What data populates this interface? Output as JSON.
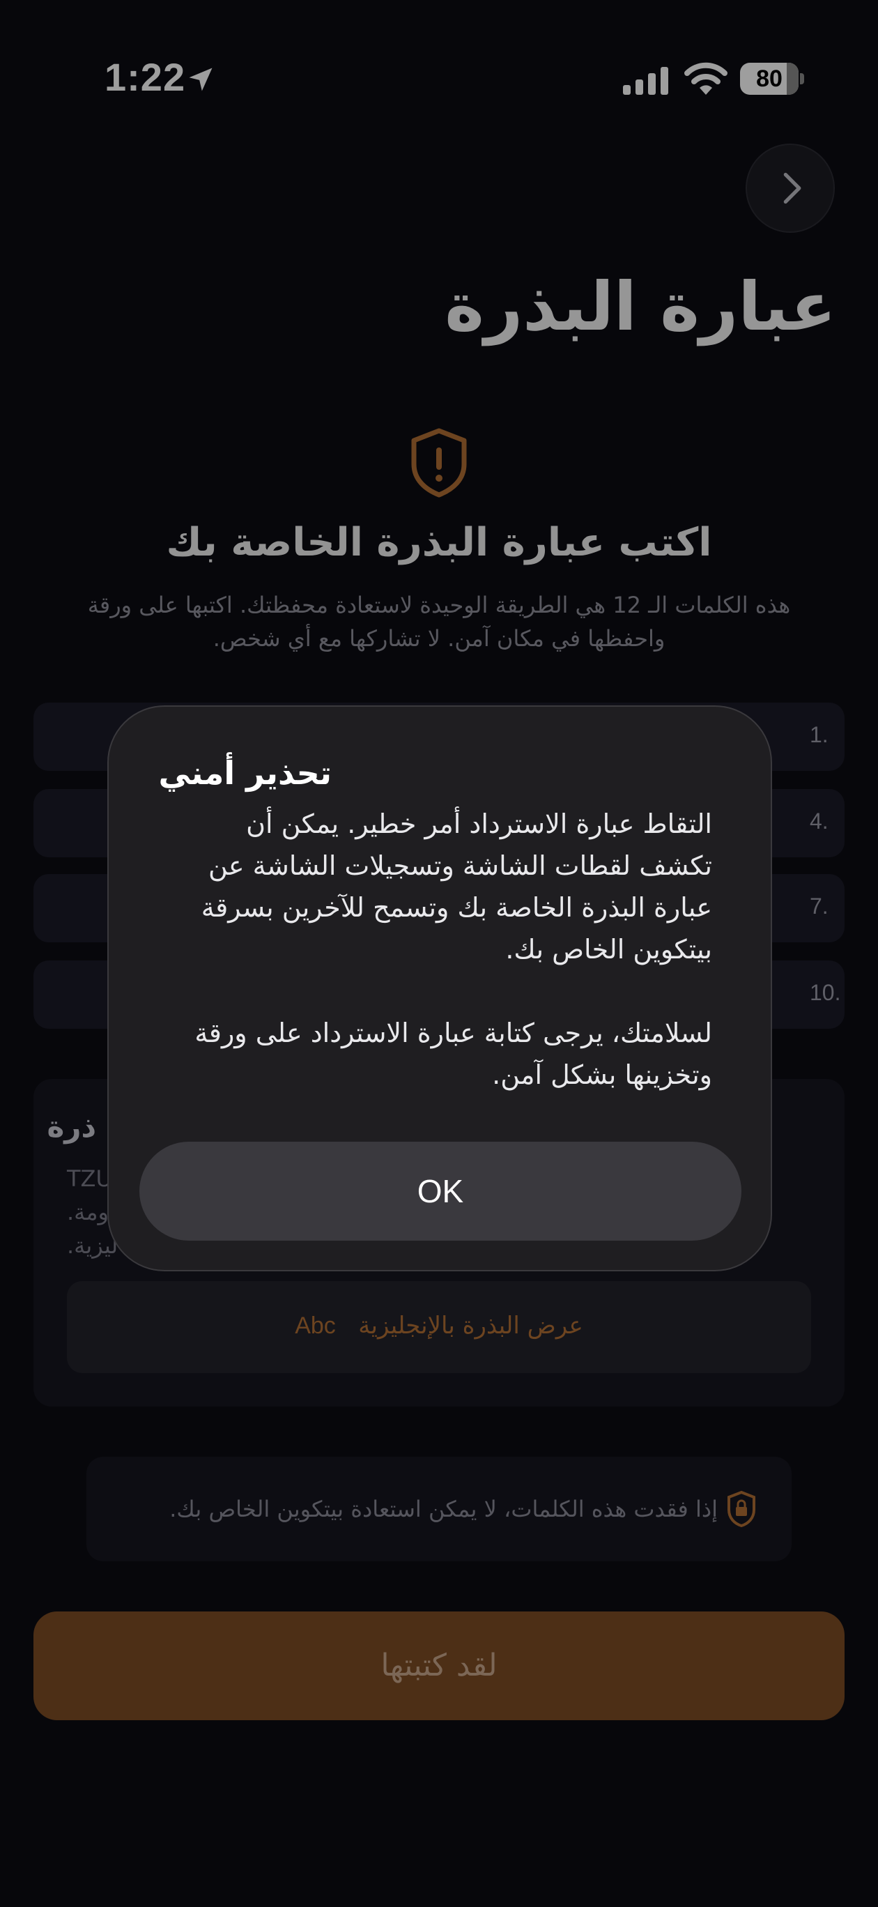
{
  "status_bar": {
    "time": "1:22",
    "battery": "80",
    "battery_level": 0.8
  },
  "header": {
    "title": "عبارة البذرة"
  },
  "main": {
    "heading": "اكتب عبارة البذرة الخاصة بك",
    "subtitle": "هذه الكلمات الـ 12 هي الطريقة الوحيدة لاستعادة محفظتك. اكتبها على ورقة واحفظها في مكان آمن. لا تشاركها مع أي شخص.",
    "word_rows": [
      "1.",
      "4.",
      "7.",
      "10."
    ],
    "seed_card": {
      "title_fragment": "ذرة",
      "text_fragments": [
        "TZU",
        "ومة.",
        "ليزية."
      ],
      "show_english_label": "عرض البذرة بالإنجليزية",
      "show_english_badge": "Abc"
    },
    "notice": "إذا فقدت هذه الكلمات، لا يمكن استعادة بيتكوين الخاص بك.",
    "primary_button": "لقد كتبتها"
  },
  "alert": {
    "title": "تحذير أمني",
    "paragraph1": "التقاط عبارة الاسترداد أمر خطير. يمكن أن تكشف لقطات الشاشة وتسجيلات الشاشة عن عبارة البذرة الخاصة بك وتسمح للآخرين بسرقة بيتكوين الخاص بك.",
    "paragraph2": "لسلامتك، يرجى كتابة عبارة الاسترداد على ورقة وتخزينها بشكل آمن.",
    "ok_label": "OK"
  },
  "colors": {
    "accent": "#b06f35",
    "primary_button": "#7c4c25",
    "background": "#0c0c12"
  }
}
